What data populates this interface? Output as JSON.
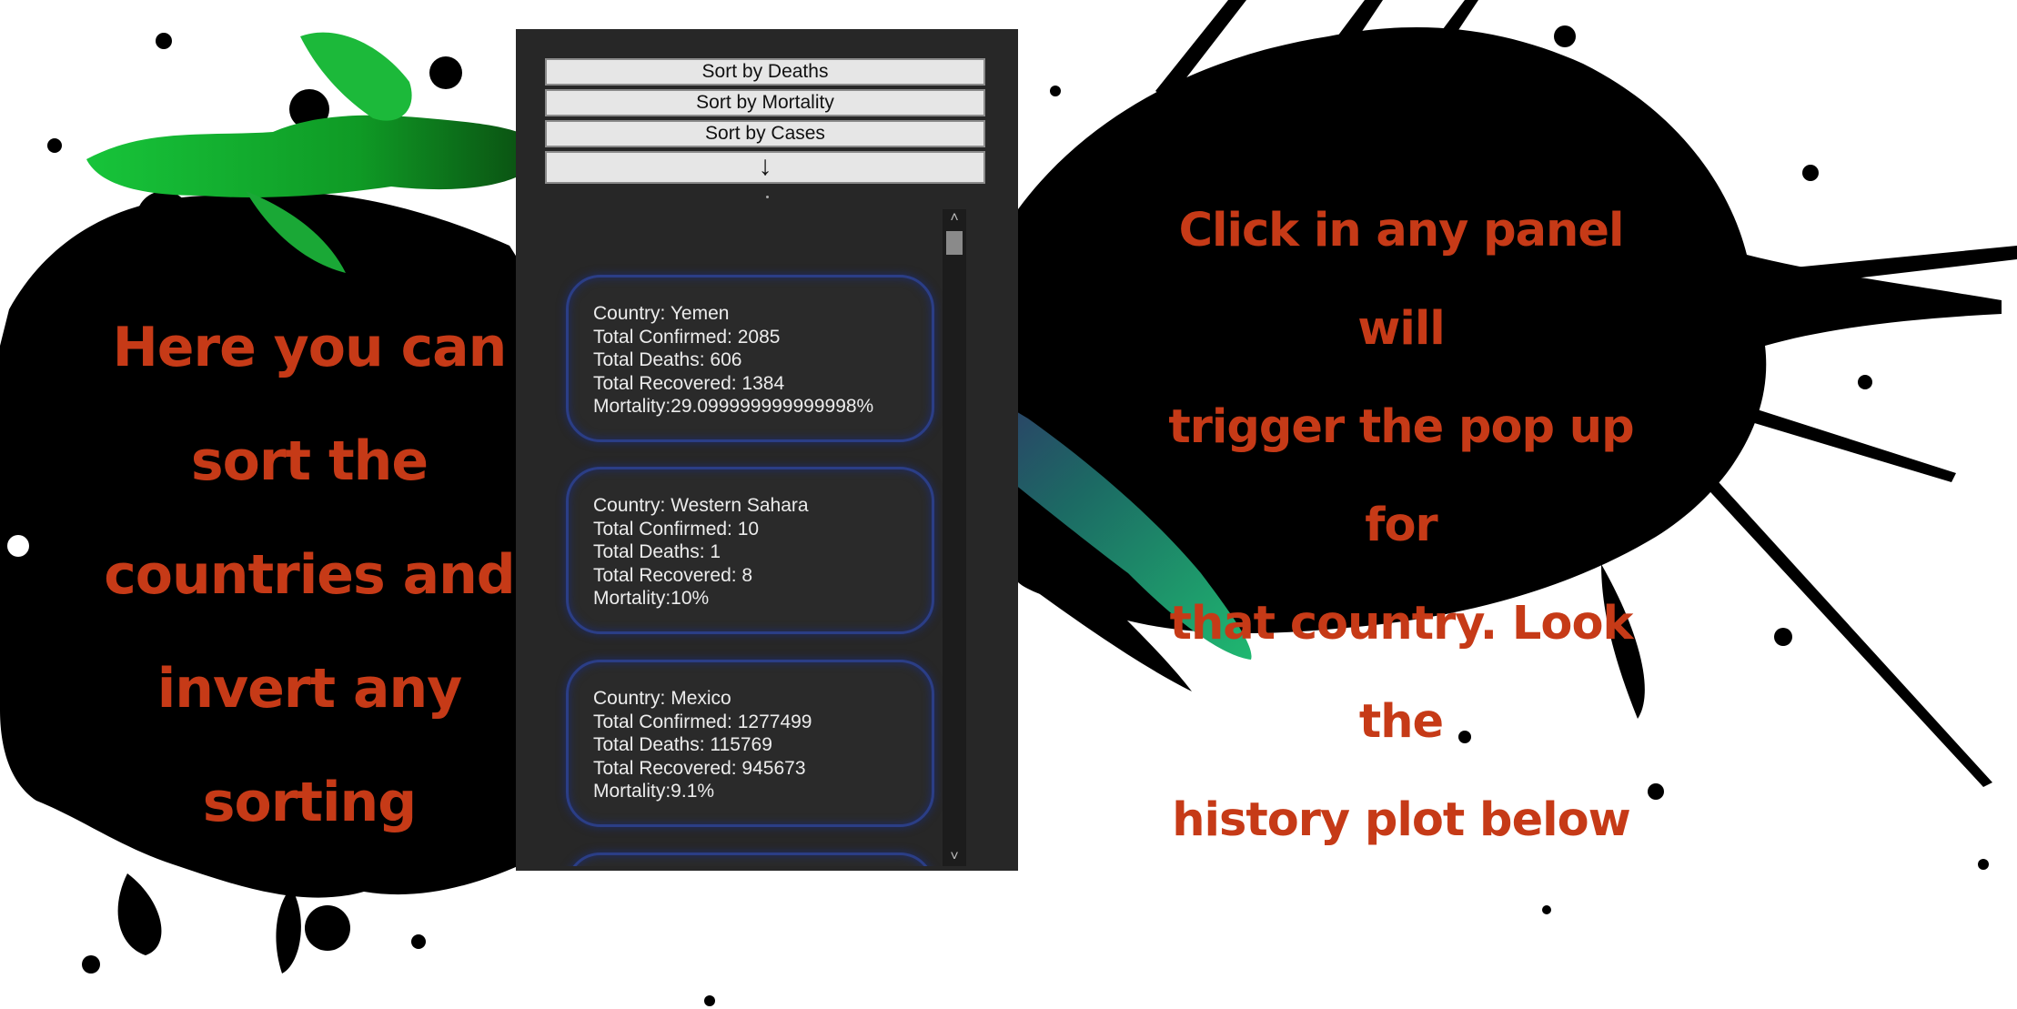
{
  "callouts": {
    "left": [
      "Here you can",
      "sort the",
      "countries and",
      "invert any",
      "sorting"
    ],
    "right": [
      "Click in any panel will",
      "trigger the pop up for",
      "that country. Look the",
      "history plot below"
    ]
  },
  "sort_buttons": {
    "deaths": "Sort by Deaths",
    "mortality": "Sort by Mortality",
    "cases": "Sort by Cases",
    "invert": "↓"
  },
  "countries": [
    {
      "country": "Country: Yemen",
      "confirmed": "Total Confirmed: 2085",
      "deaths": "Total Deaths: 606",
      "recovered": "Total Recovered: 1384",
      "mortality": "Mortality:29.099999999999998%"
    },
    {
      "country": "Country: Western Sahara",
      "confirmed": "Total Confirmed: 10",
      "deaths": "Total Deaths: 1",
      "recovered": "Total Recovered: 8",
      "mortality": "Mortality:10%"
    },
    {
      "country": "Country: Mexico",
      "confirmed": "Total Confirmed: 1277499",
      "deaths": "Total Deaths: 115769",
      "recovered": "Total Recovered: 945673",
      "mortality": "Mortality:9.1%"
    }
  ],
  "scrollbar": {
    "up_icon": "˄",
    "down_icon": "˅"
  },
  "colors": {
    "callout_text": "#c63a17",
    "panel_bg": "#272727",
    "card_border": "#2b3e86",
    "ink": "#000000"
  }
}
